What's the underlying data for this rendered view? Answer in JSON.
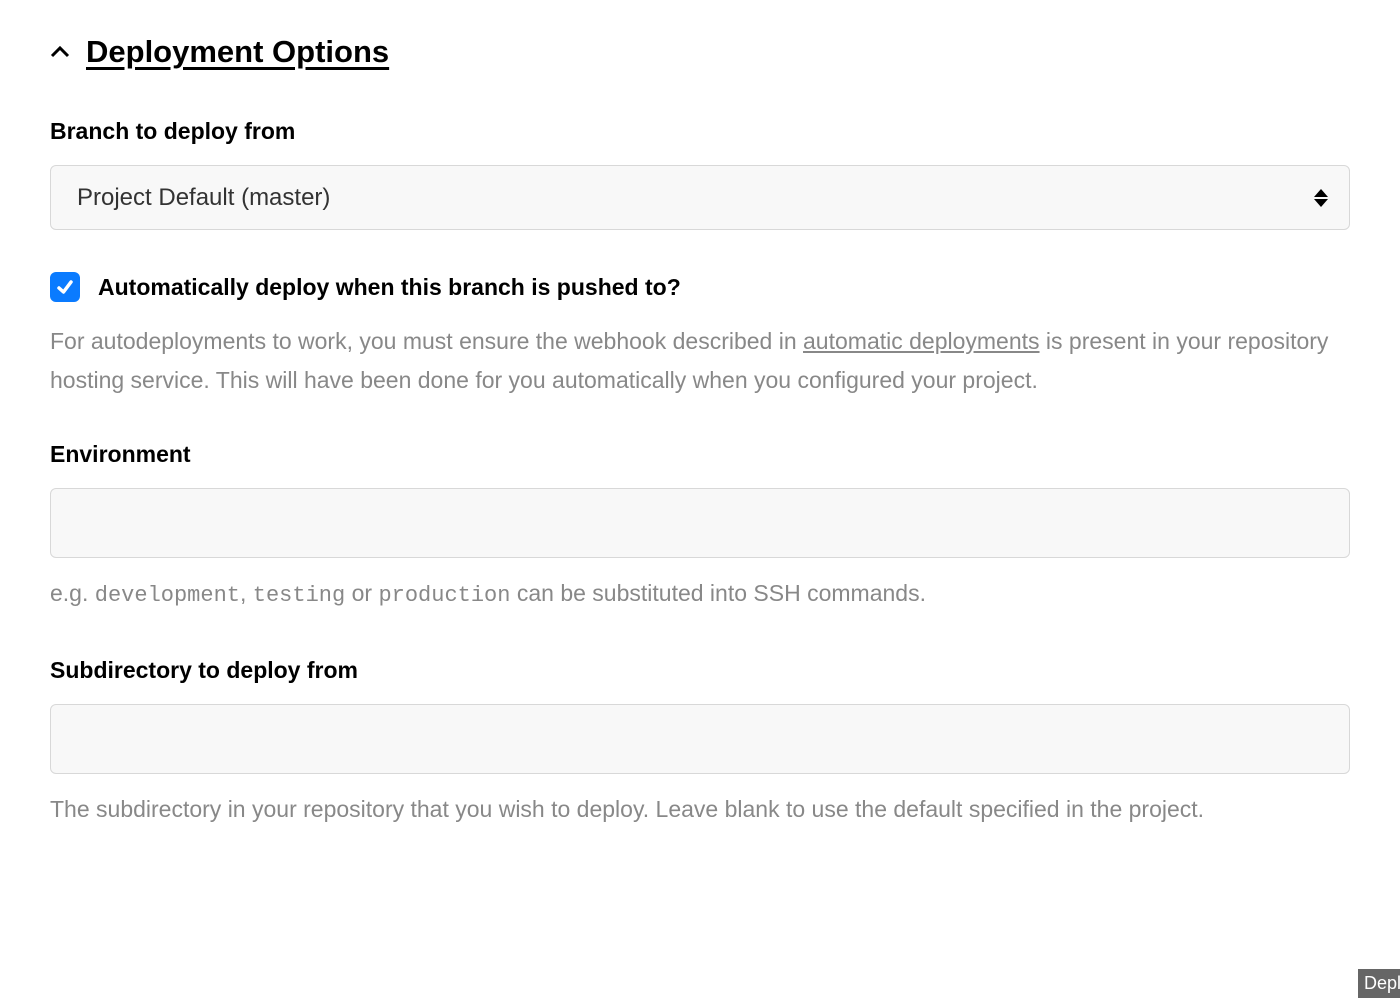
{
  "section": {
    "title": "Deployment Options"
  },
  "branch": {
    "label": "Branch to deploy from",
    "selected": "Project Default (master)"
  },
  "autoDeploy": {
    "label": "Automatically deploy when this branch is pushed to?",
    "help_prefix": "For autodeployments to work, you must ensure the webhook described in ",
    "help_link": "automatic deployments",
    "help_suffix": " is present in your repository hosting service. This will have been done for you automatically when you configured your project."
  },
  "environment": {
    "label": "Environment",
    "value": "",
    "help_prefix": "e.g. ",
    "code1": "development",
    "sep1": ", ",
    "code2": "testing",
    "sep2": " or ",
    "code3": "production",
    "help_suffix": " can be substituted into SSH commands."
  },
  "subdirectory": {
    "label": "Subdirectory to deploy from",
    "value": "",
    "help": "The subdirectory in your repository that you wish to deploy. Leave blank to use the default specified in the project."
  },
  "floating": {
    "label": "Depl"
  }
}
